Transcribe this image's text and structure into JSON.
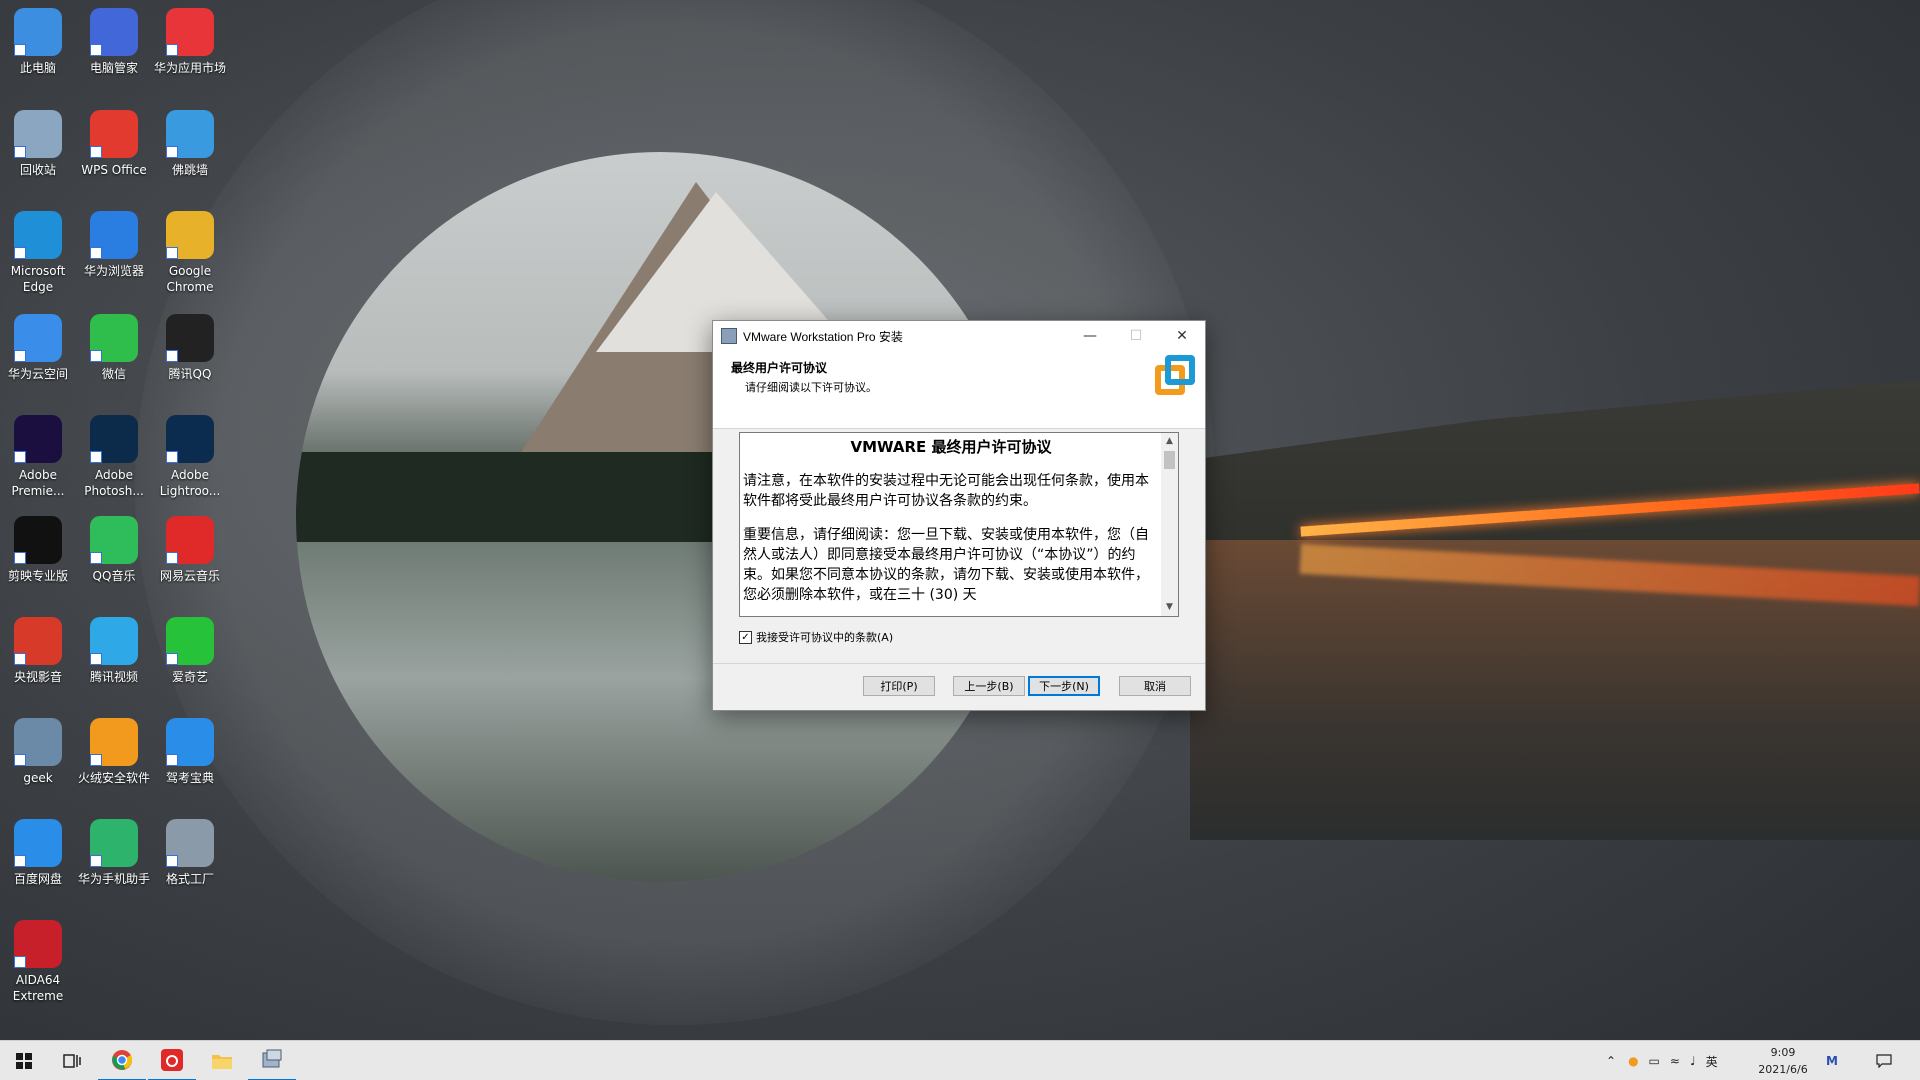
{
  "desktop_icons": [
    {
      "label": "此电脑",
      "icon": "computer-icon",
      "color": "#3c8fe0"
    },
    {
      "label": "电脑管家",
      "icon": "pc-manager-icon",
      "color": "#4267d8"
    },
    {
      "label": "华为应用市场",
      "icon": "huawei-appgallery-icon",
      "color": "#e8353a"
    },
    {
      "label": "回收站",
      "icon": "recycle-bin-icon",
      "color": "#8aa6c0"
    },
    {
      "label": "WPS Office",
      "icon": "wps-office-icon",
      "color": "#e33a2f"
    },
    {
      "label": "佛跳墙",
      "icon": "fotiaoqiang-icon",
      "color": "#3a9ae0"
    },
    {
      "label": "Microsoft Edge",
      "icon": "edge-icon",
      "color": "#1f8fd8"
    },
    {
      "label": "华为浏览器",
      "icon": "huawei-browser-icon",
      "color": "#2a7de1"
    },
    {
      "label": "Google Chrome",
      "icon": "chrome-icon",
      "color": "#e8b12a"
    },
    {
      "label": "华为云空间",
      "icon": "huawei-cloud-icon",
      "color": "#3a8de8"
    },
    {
      "label": "微信",
      "icon": "wechat-icon",
      "color": "#2fbd4b"
    },
    {
      "label": "腾讯QQ",
      "icon": "qq-icon",
      "color": "#222222"
    },
    {
      "label": "Adobe Premie...",
      "icon": "premiere-icon",
      "color": "#1a0f3f"
    },
    {
      "label": "Adobe Photosh...",
      "icon": "photoshop-icon",
      "color": "#0c2a4a"
    },
    {
      "label": "Adobe Lightroo...",
      "icon": "lightroom-icon",
      "color": "#0b2b4f"
    },
    {
      "label": "剪映专业版",
      "icon": "jianying-icon",
      "color": "#111111"
    },
    {
      "label": "QQ音乐",
      "icon": "qq-music-icon",
      "color": "#2fbd5b"
    },
    {
      "label": "网易云音乐",
      "icon": "netease-music-icon",
      "color": "#e02a2a"
    },
    {
      "label": "央视影音",
      "icon": "cctv-video-icon",
      "color": "#d83a2a"
    },
    {
      "label": "腾讯视频",
      "icon": "tencent-video-icon",
      "color": "#2fa8e8"
    },
    {
      "label": "爱奇艺",
      "icon": "iqiyi-icon",
      "color": "#25c23a"
    },
    {
      "label": "geek",
      "icon": "geek-icon",
      "color": "#6a8aa8"
    },
    {
      "label": "火绒安全软件",
      "icon": "huorong-icon",
      "color": "#f29a1d"
    },
    {
      "label": "驾考宝典",
      "icon": "jiakao-icon",
      "color": "#2a8ee8"
    },
    {
      "label": "百度网盘",
      "icon": "baidu-netdisk-icon",
      "color": "#2a8de8"
    },
    {
      "label": "华为手机助手",
      "icon": "huawei-hisuite-icon",
      "color": "#2db36b"
    },
    {
      "label": "格式工厂",
      "icon": "format-factory-icon",
      "color": "#8a9aa8"
    },
    {
      "label": "AIDA64 Extreme",
      "icon": "aida64-icon",
      "color": "#c8202a"
    }
  ],
  "dialog": {
    "title": "VMware Workstation Pro 安装",
    "header_title": "最终用户许可协议",
    "header_subtitle": "请仔细阅读以下许可协议。",
    "license_title": "VMWARE 最终用户许可协议",
    "license_p1": "请注意，在本软件的安装过程中无论可能会出现任何条款，使用本软件都将受此最终用户许可协议各条款的约束。",
    "license_p2": "重要信息，请仔细阅读：您一旦下载、安装或使用本软件，您（自然人或法人）即同意接受本最终用户许可协议（“本协议”）的约束。如果您不同意本协议的条款，请勿下载、安装或使用本软件，您必须删除本软件，或在三十 (30) 天",
    "accept_label": "我接受许可协议中的条款(A)",
    "accept_checked": true,
    "buttons": {
      "print": "打印(P)",
      "back": "上一步(B)",
      "next": "下一步(N)",
      "cancel": "取消"
    }
  },
  "taskbar": {
    "apps": [
      {
        "name": "start",
        "icon": "windows-start-icon"
      },
      {
        "name": "task-view",
        "icon": "task-view-icon"
      },
      {
        "name": "chrome",
        "icon": "chrome-icon",
        "active": true
      },
      {
        "name": "netease-music",
        "icon": "netease-music-icon",
        "active": true
      },
      {
        "name": "file-explorer",
        "icon": "folder-icon"
      },
      {
        "name": "vmware-installer",
        "icon": "installer-icon",
        "active": true
      }
    ],
    "ime": "英",
    "time": "9:09",
    "date": "2021/6/6"
  },
  "colors": {
    "accent": "#0078d7",
    "taskbar_bg": "#e8e8e8"
  }
}
